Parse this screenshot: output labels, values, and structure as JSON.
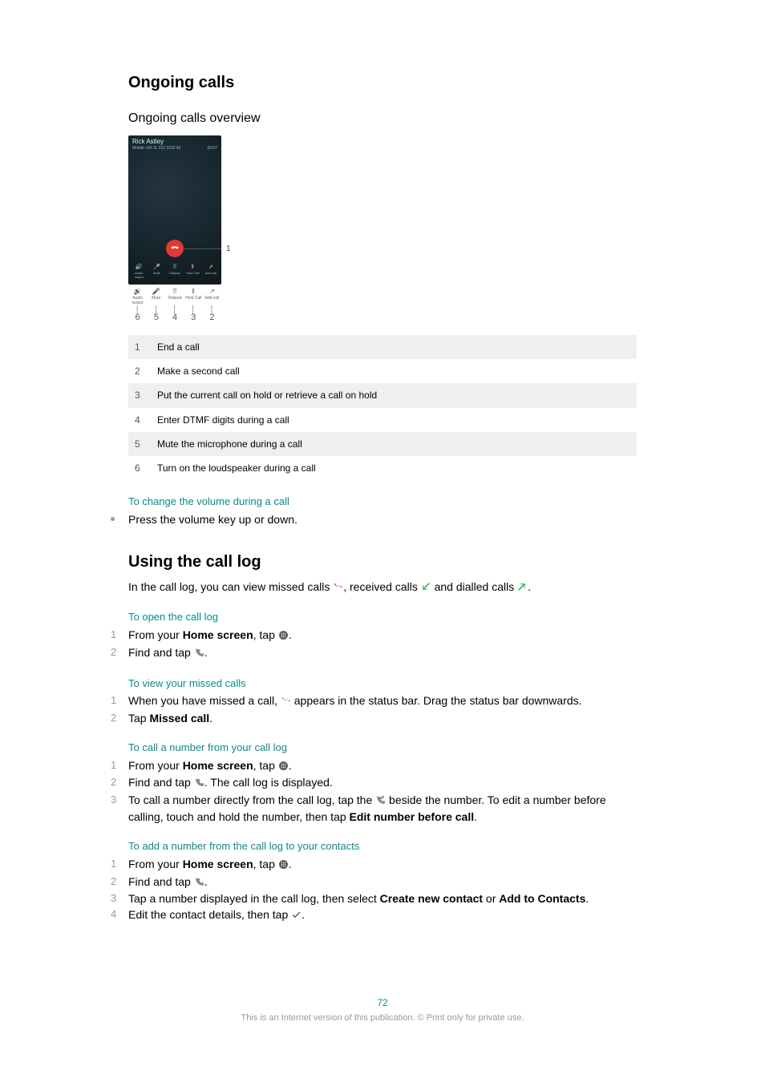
{
  "section1": {
    "title": "Ongoing calls",
    "subtitle": "Ongoing calls overview",
    "phone": {
      "caller": "Rick Astley",
      "number": "Mobile +00 11 222 3333 45",
      "duration": "00:07",
      "labels": {
        "audio": "Audio output",
        "mute": "Mute",
        "dialpad": "Dialpad",
        "hold": "Hold Call",
        "add": "Add call"
      }
    },
    "callouts": {
      "c1": "1",
      "c2": "2",
      "c3": "3",
      "c4": "4",
      "c5": "5",
      "c6": "6"
    },
    "legend": [
      {
        "n": "1",
        "t": "End a call"
      },
      {
        "n": "2",
        "t": "Make a second call"
      },
      {
        "n": "3",
        "t": "Put the current call on hold or retrieve a call on hold"
      },
      {
        "n": "4",
        "t": "Enter DTMF digits during a call"
      },
      {
        "n": "5",
        "t": "Mute the microphone during a call"
      },
      {
        "n": "6",
        "t": "Turn on the loudspeaker during a call"
      }
    ],
    "sub1": {
      "title": "To change the volume during a call",
      "item": "Press the volume key up or down."
    }
  },
  "section2": {
    "title": "Using the call log",
    "intro": {
      "a": "In the call log, you can view missed calls ",
      "b": ", received calls ",
      "c": " and dialled calls ",
      "d": "."
    },
    "sub1": {
      "title": "To open the call log",
      "s1a": "From your ",
      "s1b": "Home screen",
      "s1c": ", tap ",
      "s1d": ".",
      "s2a": "Find and tap ",
      "s2b": "."
    },
    "sub2": {
      "title": "To view your missed calls",
      "s1a": "When you have missed a call, ",
      "s1b": " appears in the status bar. Drag the status bar downwards.",
      "s2a": "Tap ",
      "s2b": "Missed call",
      "s2c": "."
    },
    "sub3": {
      "title": "To call a number from your call log",
      "s1a": "From your ",
      "s1b": "Home screen",
      "s1c": ", tap ",
      "s1d": ".",
      "s2a": "Find and tap ",
      "s2b": ". The call log is displayed.",
      "s3a": "To call a number directly from the call log, tap the ",
      "s3b": " beside the number. To edit a number before calling, touch and hold the number, then tap ",
      "s3c": "Edit number before call",
      "s3d": "."
    },
    "sub4": {
      "title": "To add a number from the call log to your contacts",
      "s1a": "From your ",
      "s1b": "Home screen",
      "s1c": ", tap ",
      "s1d": ".",
      "s2a": "Find and tap ",
      "s2b": ".",
      "s3a": "Tap a number displayed in the call log, then select ",
      "s3b": "Create new contact",
      "s3c": " or ",
      "s3d": "Add to Contacts",
      "s3e": ".",
      "s4a": "Edit the contact details, then tap ",
      "s4b": "."
    }
  },
  "pageNumber": "72",
  "footer": "This is an Internet version of this publication. © Print only for private use."
}
